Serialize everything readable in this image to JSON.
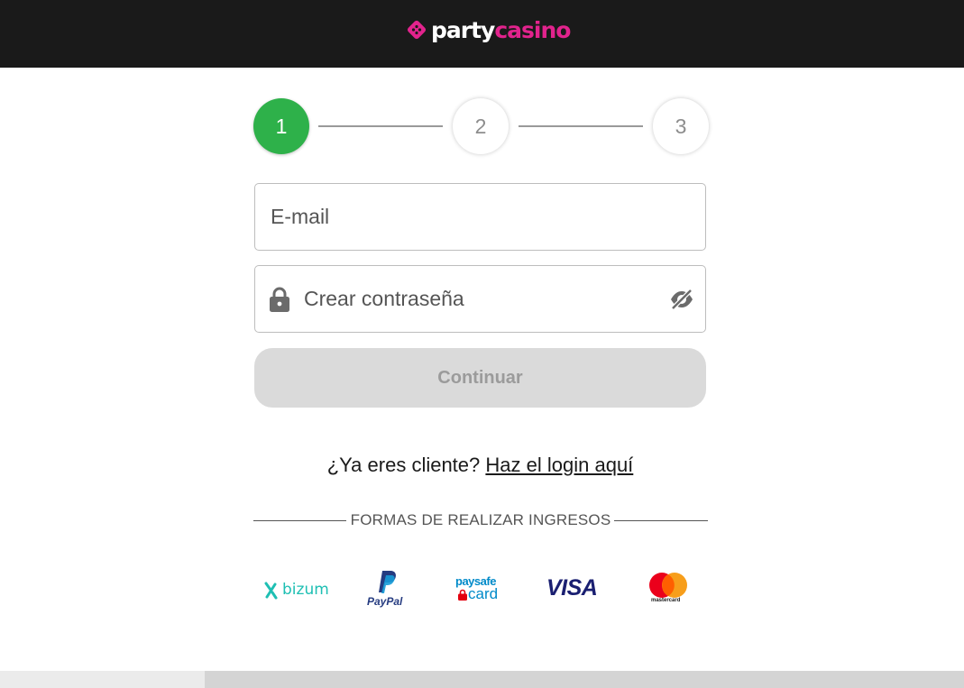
{
  "header": {
    "logo_text_party": "party",
    "logo_text_casino": "casino"
  },
  "stepper": {
    "steps": [
      {
        "label": "1",
        "state": "active"
      },
      {
        "label": "2",
        "state": "inactive"
      },
      {
        "label": "3",
        "state": "inactive"
      }
    ]
  },
  "form": {
    "email_placeholder": "E-mail",
    "password_placeholder": "Crear contraseña",
    "continue_label": "Continuar"
  },
  "login": {
    "prompt": "¿Ya eres cliente?",
    "link_label": "Haz el login aquí"
  },
  "payments": {
    "title": "FORMAS DE REALIZAR INGRESOS",
    "methods": [
      {
        "name": "bizum",
        "label": "bizum"
      },
      {
        "name": "paypal",
        "label": "PayPal"
      },
      {
        "name": "paysafecard",
        "label_top": "paysafe",
        "label_bottom": "card"
      },
      {
        "name": "visa",
        "label": "VISA"
      },
      {
        "name": "mastercard",
        "label": "mastercard"
      }
    ]
  },
  "colors": {
    "brand_pink": "#e2238d",
    "step_active": "#2eb14a",
    "header_bg": "#1a1a1a",
    "button_disabled": "#dadada"
  }
}
